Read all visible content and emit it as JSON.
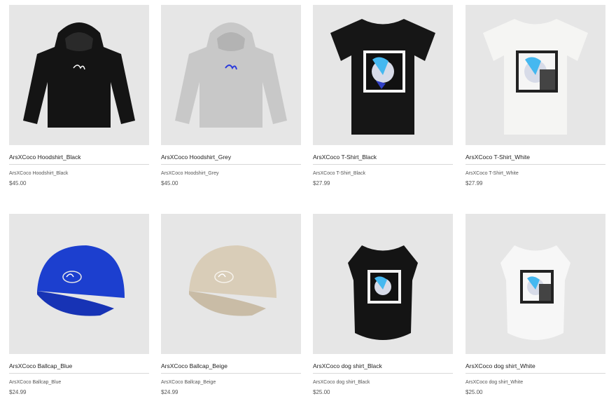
{
  "products": [
    {
      "title": "ArsXCoco Hoodshirt_Black",
      "subtitle": "ArsXCoco Hoodshirt_Black",
      "price": "$45.00",
      "image": "hoodie",
      "color": "#141414"
    },
    {
      "title": "ArsXCoco Hoodshirt_Grey",
      "subtitle": "ArsXCoco Hoodshirt_Grey",
      "price": "$45.00",
      "image": "hoodie",
      "color": "#c8c8c8"
    },
    {
      "title": "ArsXCoco T-Shirt_Black",
      "subtitle": "ArsXCoco T-Shirt_Black",
      "price": "$27.99",
      "image": "tshirt",
      "color": "#161616"
    },
    {
      "title": "ArsXCoco T-Shirt_White",
      "subtitle": "ArsXCoco T-Shirt_White",
      "price": "$27.99",
      "image": "tshirt",
      "color": "#f5f5f3"
    },
    {
      "title": "ArsXCoco Ballcap_Blue",
      "subtitle": "ArsXCoco Ballcap_Blue",
      "price": "$24.99",
      "image": "cap",
      "color": "#1c3fcf"
    },
    {
      "title": "ArsXCoco Ballcap_Beige",
      "subtitle": "ArsXCoco Ballcap_Beige",
      "price": "$24.99",
      "image": "cap",
      "color": "#d9cdb8"
    },
    {
      "title": "ArsXCoco dog shirt_Black",
      "subtitle": "ArsXCoco dog shirt_Black",
      "price": "$25.00",
      "image": "dogshirt",
      "color": "#141414"
    },
    {
      "title": "ArsXCoco dog shirt_White",
      "subtitle": "ArsXCoco dog shirt_White",
      "price": "$25.00",
      "image": "dogshirt",
      "color": "#f7f7f7"
    }
  ]
}
